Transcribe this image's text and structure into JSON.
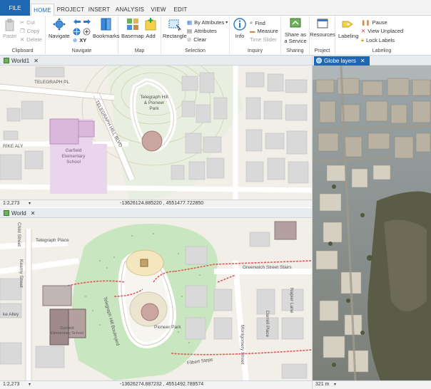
{
  "tabs": {
    "file": "FILE",
    "items": [
      {
        "label": "HOME",
        "active": true
      },
      {
        "label": "PROJECT"
      },
      {
        "label": "INSERT"
      },
      {
        "label": "ANALYSIS"
      },
      {
        "label": "VIEW"
      },
      {
        "label": "EDIT"
      }
    ]
  },
  "ribbon": {
    "clipboard": {
      "label": "Clipboard",
      "paste": "Paste",
      "cut": "Cut",
      "copy": "Copy",
      "delete": "Delete"
    },
    "navigate": {
      "label": "Navigate",
      "navigate": "Navigate",
      "xy": "XY",
      "bookmarks": "Bookmarks"
    },
    "map": {
      "label": "Map",
      "basemap": "Basemap",
      "add": "Add"
    },
    "selection": {
      "label": "Selection",
      "rectangle": "Rectangle",
      "by_attributes": "By Attributes",
      "attributes": "Attributes",
      "clear": "Clear"
    },
    "inquiry": {
      "label": "Inquiry",
      "info": "Info",
      "find": "Find",
      "measure": "Measure",
      "time_slider": "Time Slider"
    },
    "sharing": {
      "label": "Sharing",
      "share_as_service": "Share as a Service"
    },
    "project": {
      "label": "Project",
      "resources": "Resources"
    },
    "labeling": {
      "label": "Labeling",
      "labeling": "Labeling",
      "pause": "Pause",
      "view_unplaced": "View Unplaced",
      "lock_labels": "Lock Labels"
    }
  },
  "panes": {
    "world1": {
      "tab": "World1",
      "scale": "1:2,273",
      "coords": "-13626124.885220 , 4551477.722850",
      "labels": {
        "telegraph_pl": "TELEGRAPH PL",
        "telegraph_hill_blvd": "TELEGRAPH HILL BLVD",
        "park": "Telegraph Hill & Pioneer Park",
        "rike_aly": "RIKE ALY",
        "school": "Garfield Elementary School"
      }
    },
    "world": {
      "tab": "World",
      "scale": "1:2,273",
      "coords": "-13626274.887232 , 4551492.789574",
      "labels": {
        "child_street": "Child Street",
        "telegraph_place": "Telegraph Place",
        "greenwich_stairs": "Greenwich Street Stairs",
        "telegraph_hill_boulevard": "Telegraph Hill Boulevard",
        "darrell_place": "Darrell Place",
        "napier_lane": "Napier Lane",
        "montgomery_street": "Montgomery Street",
        "kearny_street": "Kearny Street",
        "ke_alley": "ke Alley",
        "school": "Garfield Elementary School",
        "pioneer_park": "Pioneer Park",
        "filbert_steps": "Filbert Steps"
      }
    },
    "globe": {
      "tab": "Globe layers",
      "scale": "321 m"
    }
  },
  "colors": {
    "accent": "#1f67b1",
    "park_green": "#c8e6c0",
    "school_purple": "#d9b8dc",
    "footpath": "#e05a5a"
  }
}
